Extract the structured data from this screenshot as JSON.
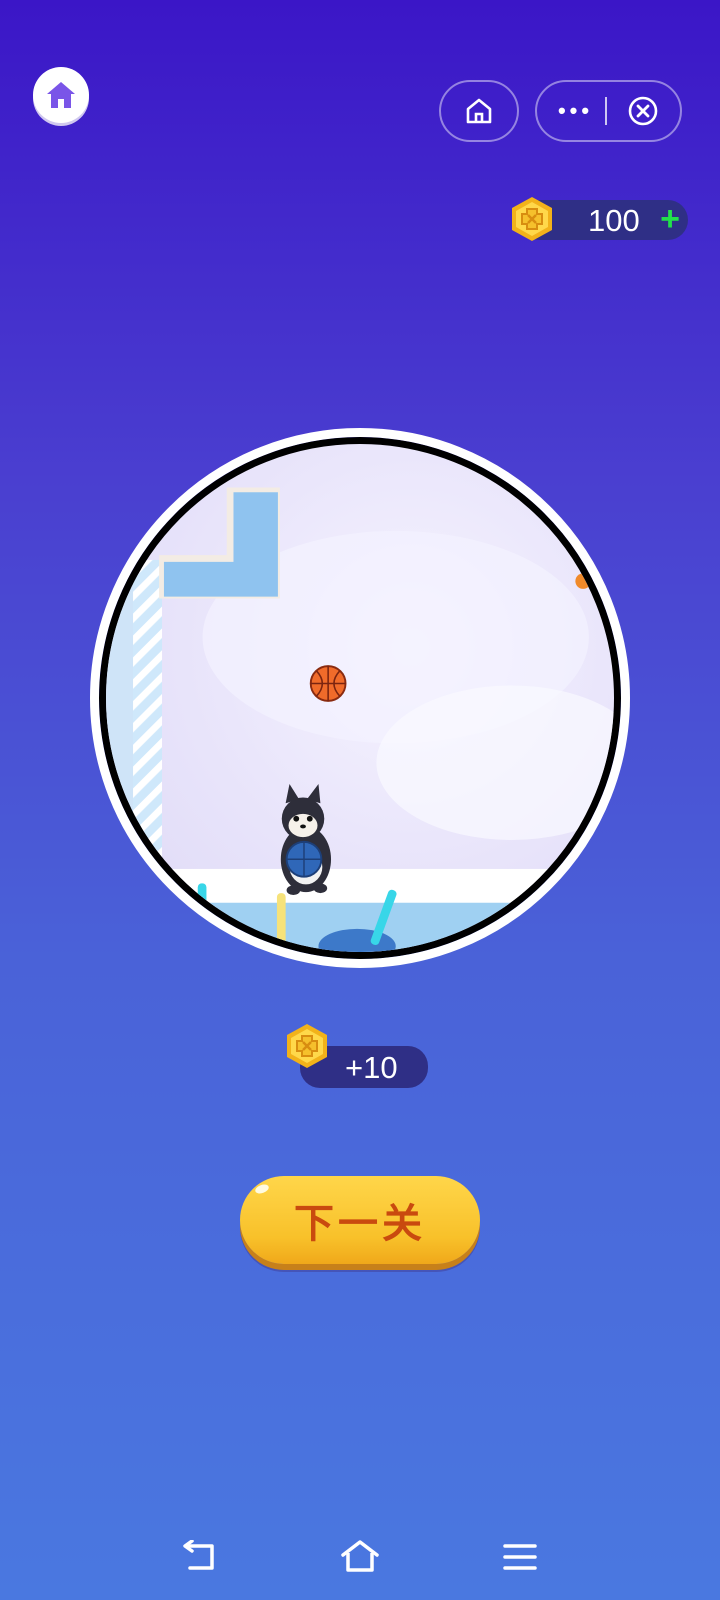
{
  "top_bar": {
    "home_button_icon": "house-icon",
    "capsule_home_icon": "house-outline-icon",
    "menu_icon": "more-dots-icon",
    "close_icon": "close-circle-icon",
    "dots_text": "•••"
  },
  "coins": {
    "balance": "100",
    "add_symbol": "+",
    "coin_icon": "gold-hex-coin-icon"
  },
  "scene": {
    "elements": [
      "platform-block",
      "striped-pillar",
      "basketball",
      "dog-character-holding-ball",
      "colored-sticks"
    ],
    "colors": {
      "block": "#8fc3ef",
      "pillar": "#a8d4f5",
      "ball": "#f06b2a",
      "floor": "#dbeefb"
    }
  },
  "reward": {
    "amount": "+10"
  },
  "next_button": {
    "label": "下一关"
  },
  "system_nav": {
    "back_icon": "back-arrow-icon",
    "home_icon": "home-outline-icon",
    "menu_icon": "menu-lines-icon"
  },
  "colors": {
    "bg_top": "#3b16c7",
    "bg_bottom": "#4a78e0",
    "button_yellow": "#f8c12a",
    "button_text": "#c94a0f",
    "plus_green": "#22e04b"
  }
}
